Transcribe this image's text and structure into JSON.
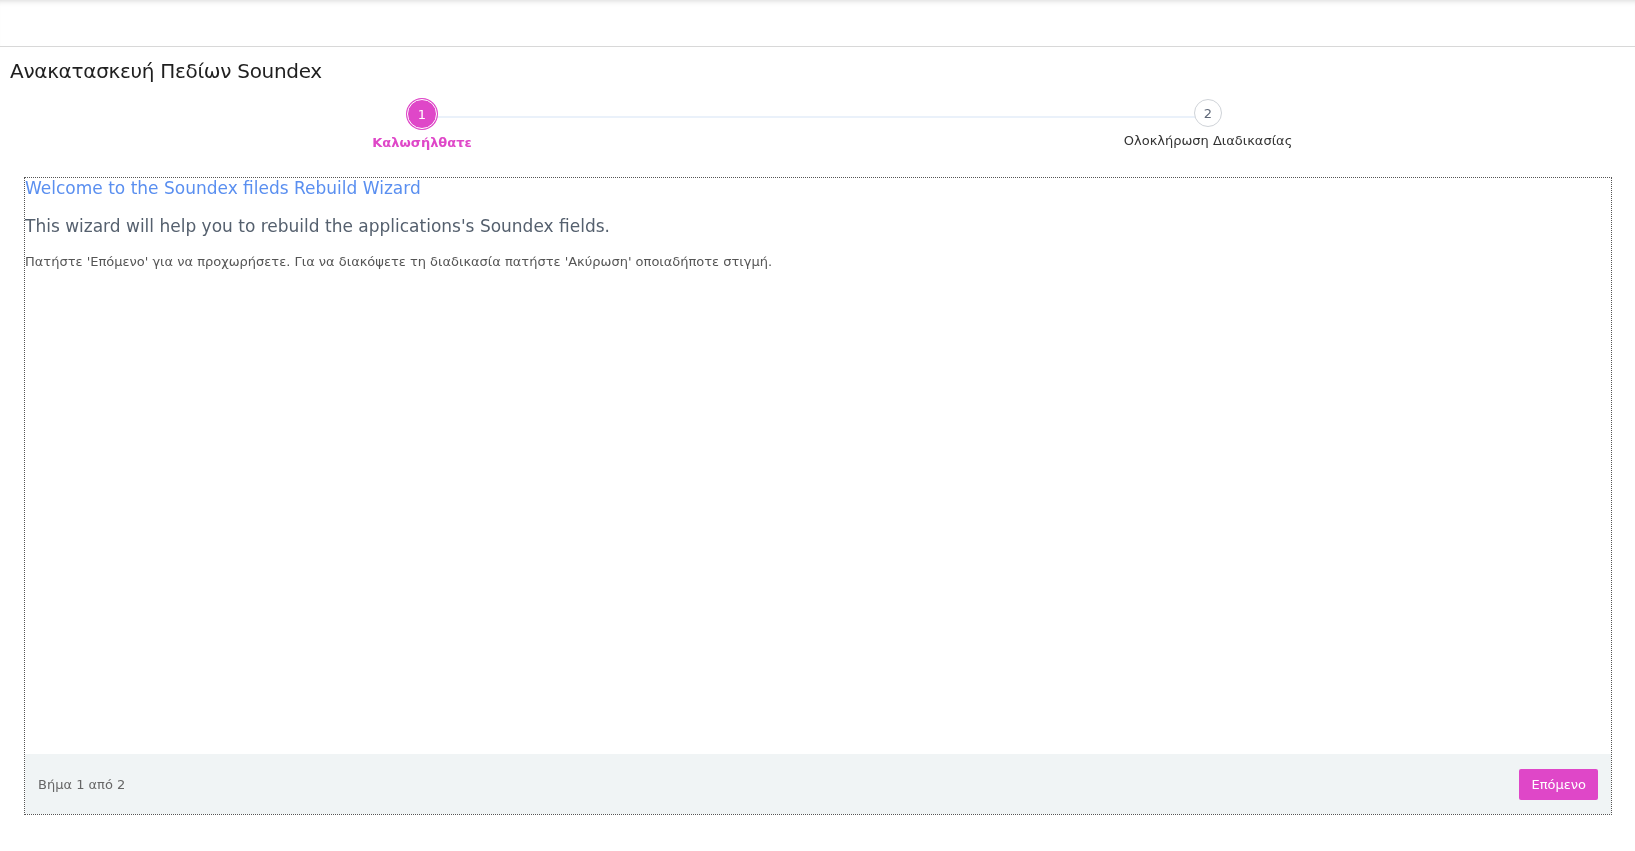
{
  "page": {
    "title": "Ανακατασκευή Πεδίων Soundex"
  },
  "steps": [
    {
      "number": "1",
      "label": "Καλωσήλθατε",
      "selected": true
    },
    {
      "number": "2",
      "label": "Ολοκλήρωση Διαδικασίας",
      "selected": false
    }
  ],
  "content": {
    "heading": "Welcome to the Soundex fileds Rebuild Wizard",
    "lead": "This wizard will help you to rebuild the applications's Soundex fields.",
    "instruction": "Πατήστε 'Επόμενο' για να προχωρήσετε. Για να διακόψετε τη διαδικασία πατήστε 'Ακύρωση' οποιαδήποτε στιγμή."
  },
  "footer": {
    "step_info": "Βήμα 1 από 2",
    "next_button": "Επόμενο"
  }
}
